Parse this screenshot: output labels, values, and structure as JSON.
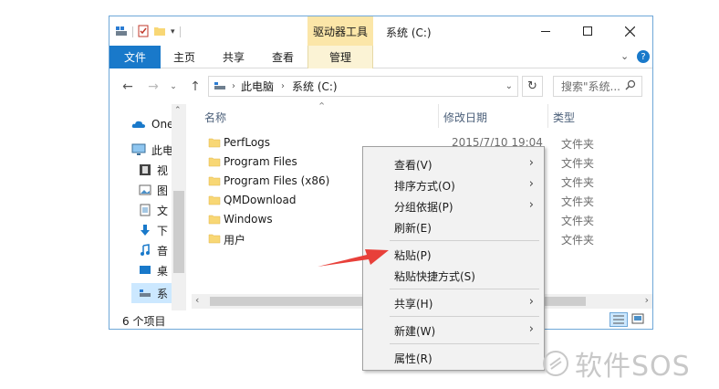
{
  "window": {
    "title": "系统 (C:)",
    "context_tool_title": "驱动器工具",
    "controls": [
      "minimize",
      "maximize",
      "close"
    ]
  },
  "ribbon": {
    "tabs": [
      {
        "label": "文件",
        "active": true
      },
      {
        "label": "主页"
      },
      {
        "label": "共享"
      },
      {
        "label": "查看"
      },
      {
        "label": "管理"
      }
    ]
  },
  "address": {
    "crumbs": [
      "此电脑",
      "系统 (C:)"
    ],
    "search_placeholder": "搜索\"系统..."
  },
  "nav_pane": {
    "items": [
      {
        "label": "One",
        "icon": "onedrive-icon"
      },
      {
        "label": "此电",
        "icon": "this-pc-icon"
      },
      {
        "label": "视",
        "icon": "video-icon"
      },
      {
        "label": "图",
        "icon": "pictures-icon"
      },
      {
        "label": "文",
        "icon": "documents-icon"
      },
      {
        "label": "下",
        "icon": "download-icon"
      },
      {
        "label": "音",
        "icon": "music-icon"
      },
      {
        "label": "桌",
        "icon": "desktop-icon"
      },
      {
        "label": "系",
        "icon": "drive-icon"
      }
    ]
  },
  "columns": {
    "name": "名称",
    "date": "修改日期",
    "type": "类型"
  },
  "files": [
    {
      "name": "PerfLogs",
      "date": "2015/7/10 19:04",
      "type": "文件夹"
    },
    {
      "name": "Program Files",
      "date": "",
      "type": "文件夹"
    },
    {
      "name": "Program Files (x86)",
      "date": "",
      "type": "文件夹"
    },
    {
      "name": "QMDownload",
      "date": "",
      "type": "文件夹"
    },
    {
      "name": "Windows",
      "date": "",
      "type": "文件夹"
    },
    {
      "name": "用户",
      "date": "",
      "type": "文件夹"
    }
  ],
  "status": {
    "item_count": "6 个项目"
  },
  "context_menu": {
    "items": [
      {
        "label": "查看(V)",
        "submenu": true
      },
      {
        "label": "排序方式(O)",
        "submenu": true
      },
      {
        "label": "分组依据(P)",
        "submenu": true
      },
      {
        "label": "刷新(E)"
      },
      {
        "label": "粘贴(P)"
      },
      {
        "label": "粘贴快捷方式(S)"
      },
      {
        "label": "共享(H)",
        "submenu": true
      },
      {
        "label": "新建(W)",
        "submenu": true
      },
      {
        "label": "属性(R)"
      }
    ]
  },
  "watermark": {
    "text": "软件SOS"
  },
  "colors": {
    "accent": "#1979ca",
    "context_tab": "#fbe6a8",
    "folder": "#f8d775",
    "arrow": "#e8403a"
  }
}
